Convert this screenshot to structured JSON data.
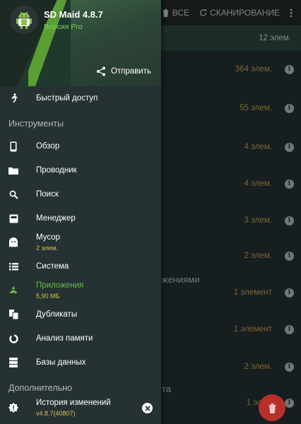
{
  "background": {
    "toolbar": {
      "delete_all_label": "ВСЕ",
      "scan_label": "СКАНИРОВАНИЕ"
    },
    "header_count": "12 элем.",
    "rows": [
      {
        "count": "364 элем."
      },
      {
        "count": "55 элем."
      },
      {
        "count": "4 элем."
      },
      {
        "count": "4 элем."
      },
      {
        "count": "3 элем."
      },
      {
        "count": "2 элем."
      },
      {
        "count": "1 элемент"
      },
      {
        "count": "1 элемент"
      },
      {
        "count": "2 элем."
      },
      {
        "count": "1 элем"
      }
    ],
    "section_fragment_1": "жениями",
    "section_fragment_2": "та"
  },
  "drawer": {
    "app_name": "SD Maid 4.8.7",
    "app_edition": "Версия Pro",
    "share_label": "Отправить",
    "quick_access_label": "Быстрый доступ",
    "tools_section": "Инструменты",
    "items": [
      {
        "label": "Обзор",
        "icon": "phone-icon"
      },
      {
        "label": "Проводник",
        "icon": "folder-icon"
      },
      {
        "label": "Поиск",
        "icon": "search-icon"
      },
      {
        "label": "Менеджер",
        "icon": "app-manager-icon"
      },
      {
        "label": "Мусор",
        "sub": "2 элем.",
        "icon": "ghost-icon"
      },
      {
        "label": "Система",
        "icon": "list-icon"
      },
      {
        "label": "Приложения",
        "sub": "5,90 МБ",
        "icon": "recycle-icon"
      },
      {
        "label": "Дубликаты",
        "icon": "duplicates-icon"
      },
      {
        "label": "Анализ памяти",
        "icon": "storage-analyzer-icon"
      },
      {
        "label": "Базы данных",
        "icon": "database-icon"
      }
    ],
    "extra_section": "Дополнительно",
    "changelog": {
      "label": "История изменений",
      "sub": "v4.8.7(40807)"
    }
  },
  "colors": {
    "accent_green": "#64c043",
    "version_green": "#7fd05a",
    "count_orange": "#c9a25a",
    "fab_red": "#b8302b"
  }
}
